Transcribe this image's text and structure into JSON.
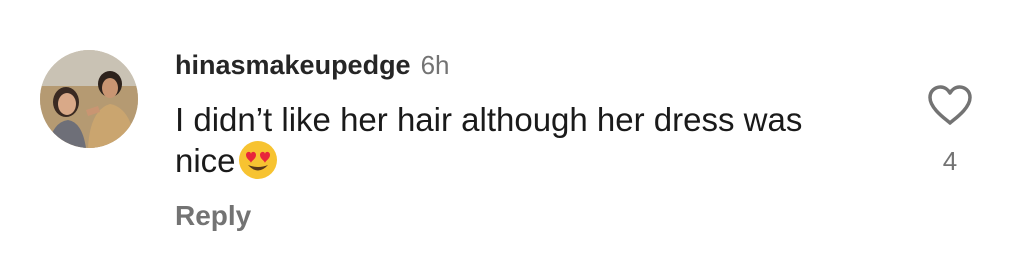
{
  "comment": {
    "username": "hinasmakeupedge",
    "time": "6h",
    "text": "I didn’t like her hair although her dress was nice",
    "emoji": "heart-eyes-emoji",
    "reply_label": "Reply",
    "like_count": "4",
    "like_icon": "heart-outline-icon",
    "avatar": "user-avatar"
  },
  "colors": {
    "username": "#262626",
    "muted": "#737373",
    "text": "#1a1a1a",
    "emoji": "#f7c331",
    "heart_eyes": "#e8263b"
  }
}
